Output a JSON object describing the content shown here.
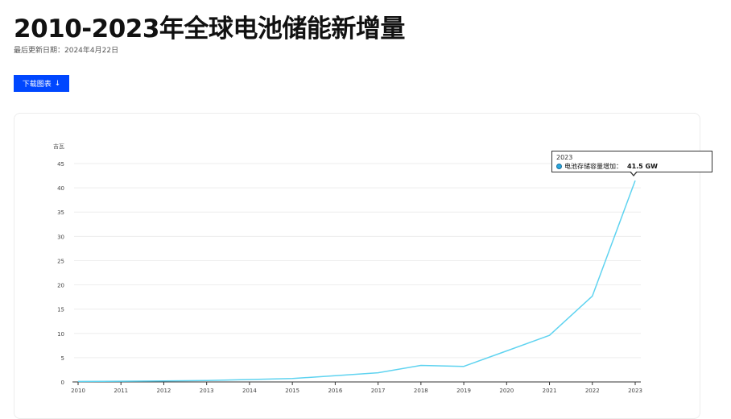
{
  "page": {
    "title": "2010-2023年全球电池储能新增量",
    "updated": "最后更新日期：2024年4月22日",
    "download_label": "下载图表"
  },
  "tooltip": {
    "year": "2023",
    "label": "电池存储容量增加：",
    "value": "41.5 GW"
  },
  "colors": {
    "line": "#5fd3f0",
    "accent": "#0047ff",
    "grid": "#ededed"
  },
  "chart_data": {
    "type": "line",
    "ylabel": "吉瓦",
    "ylim": [
      0,
      45
    ],
    "yticks": [
      0,
      5,
      10,
      15,
      20,
      25,
      30,
      35,
      40,
      45
    ],
    "x": [
      "2010",
      "2011",
      "2012",
      "2013",
      "2014",
      "2015",
      "2016",
      "2017",
      "2018",
      "2019",
      "2020",
      "2021",
      "2022",
      "2023"
    ],
    "series": [
      {
        "name": "电池存储容量增加",
        "values": [
          0.1,
          0.15,
          0.2,
          0.3,
          0.5,
          0.7,
          1.3,
          1.9,
          3.4,
          3.2,
          6.4,
          9.6,
          17.7,
          41.5
        ]
      }
    ],
    "grid": true
  }
}
